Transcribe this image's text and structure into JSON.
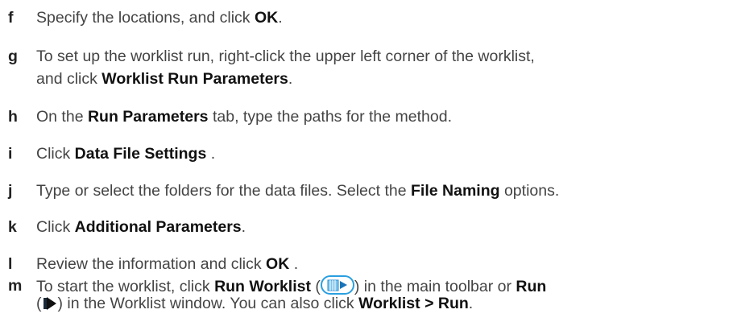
{
  "steps": [
    {
      "letter": "f",
      "line1": {
        "t1": "Specify the locations, and click ",
        "b1": "OK",
        "t2": "."
      }
    },
    {
      "letter": "g",
      "line1": {
        "t1": "To set up the worklist run, right-click the upper left corner of the worklist,"
      },
      "line2": {
        "t1": "and click ",
        "b1": "Worklist Run Parameters",
        "t2": "."
      }
    },
    {
      "letter": "h",
      "line1": {
        "t1": "On the ",
        "b1": "Run Parameters",
        "t2": " tab, type the paths for the method."
      }
    },
    {
      "letter": "i",
      "line1": {
        "t1": "Click ",
        "b1": "Data File Settings",
        "t2": " ."
      }
    },
    {
      "letter": "j",
      "line1": {
        "t1": "Type or select the folders for the data files. Select the ",
        "b1": "File Naming",
        "t2": " options."
      }
    },
    {
      "letter": "k",
      "line1": {
        "t1": "Click ",
        "b1": "Additional Parameters",
        "t2": "."
      }
    },
    {
      "letter": "l",
      "line1": {
        "t1": "Review the information and click ",
        "b1": "OK",
        "t2": " ."
      }
    },
    {
      "letter": "m",
      "line1": {
        "t1": "To start the worklist, click ",
        "b1": "Run Worklist",
        "t2": " (",
        "t3": ") in the main toolbar or ",
        "b2": "Run"
      },
      "line2": {
        "t1": "(",
        "t2": ") in the Worklist window. You can also click ",
        "b1": "Worklist > Run",
        "t3": "."
      }
    }
  ],
  "icons": {
    "run_worklist": "run-worklist-toolbar-icon",
    "run": "run-play-icon"
  },
  "colors": {
    "text": "#444444",
    "bold": "#111111",
    "icon_blue": "#2a9fe0"
  }
}
